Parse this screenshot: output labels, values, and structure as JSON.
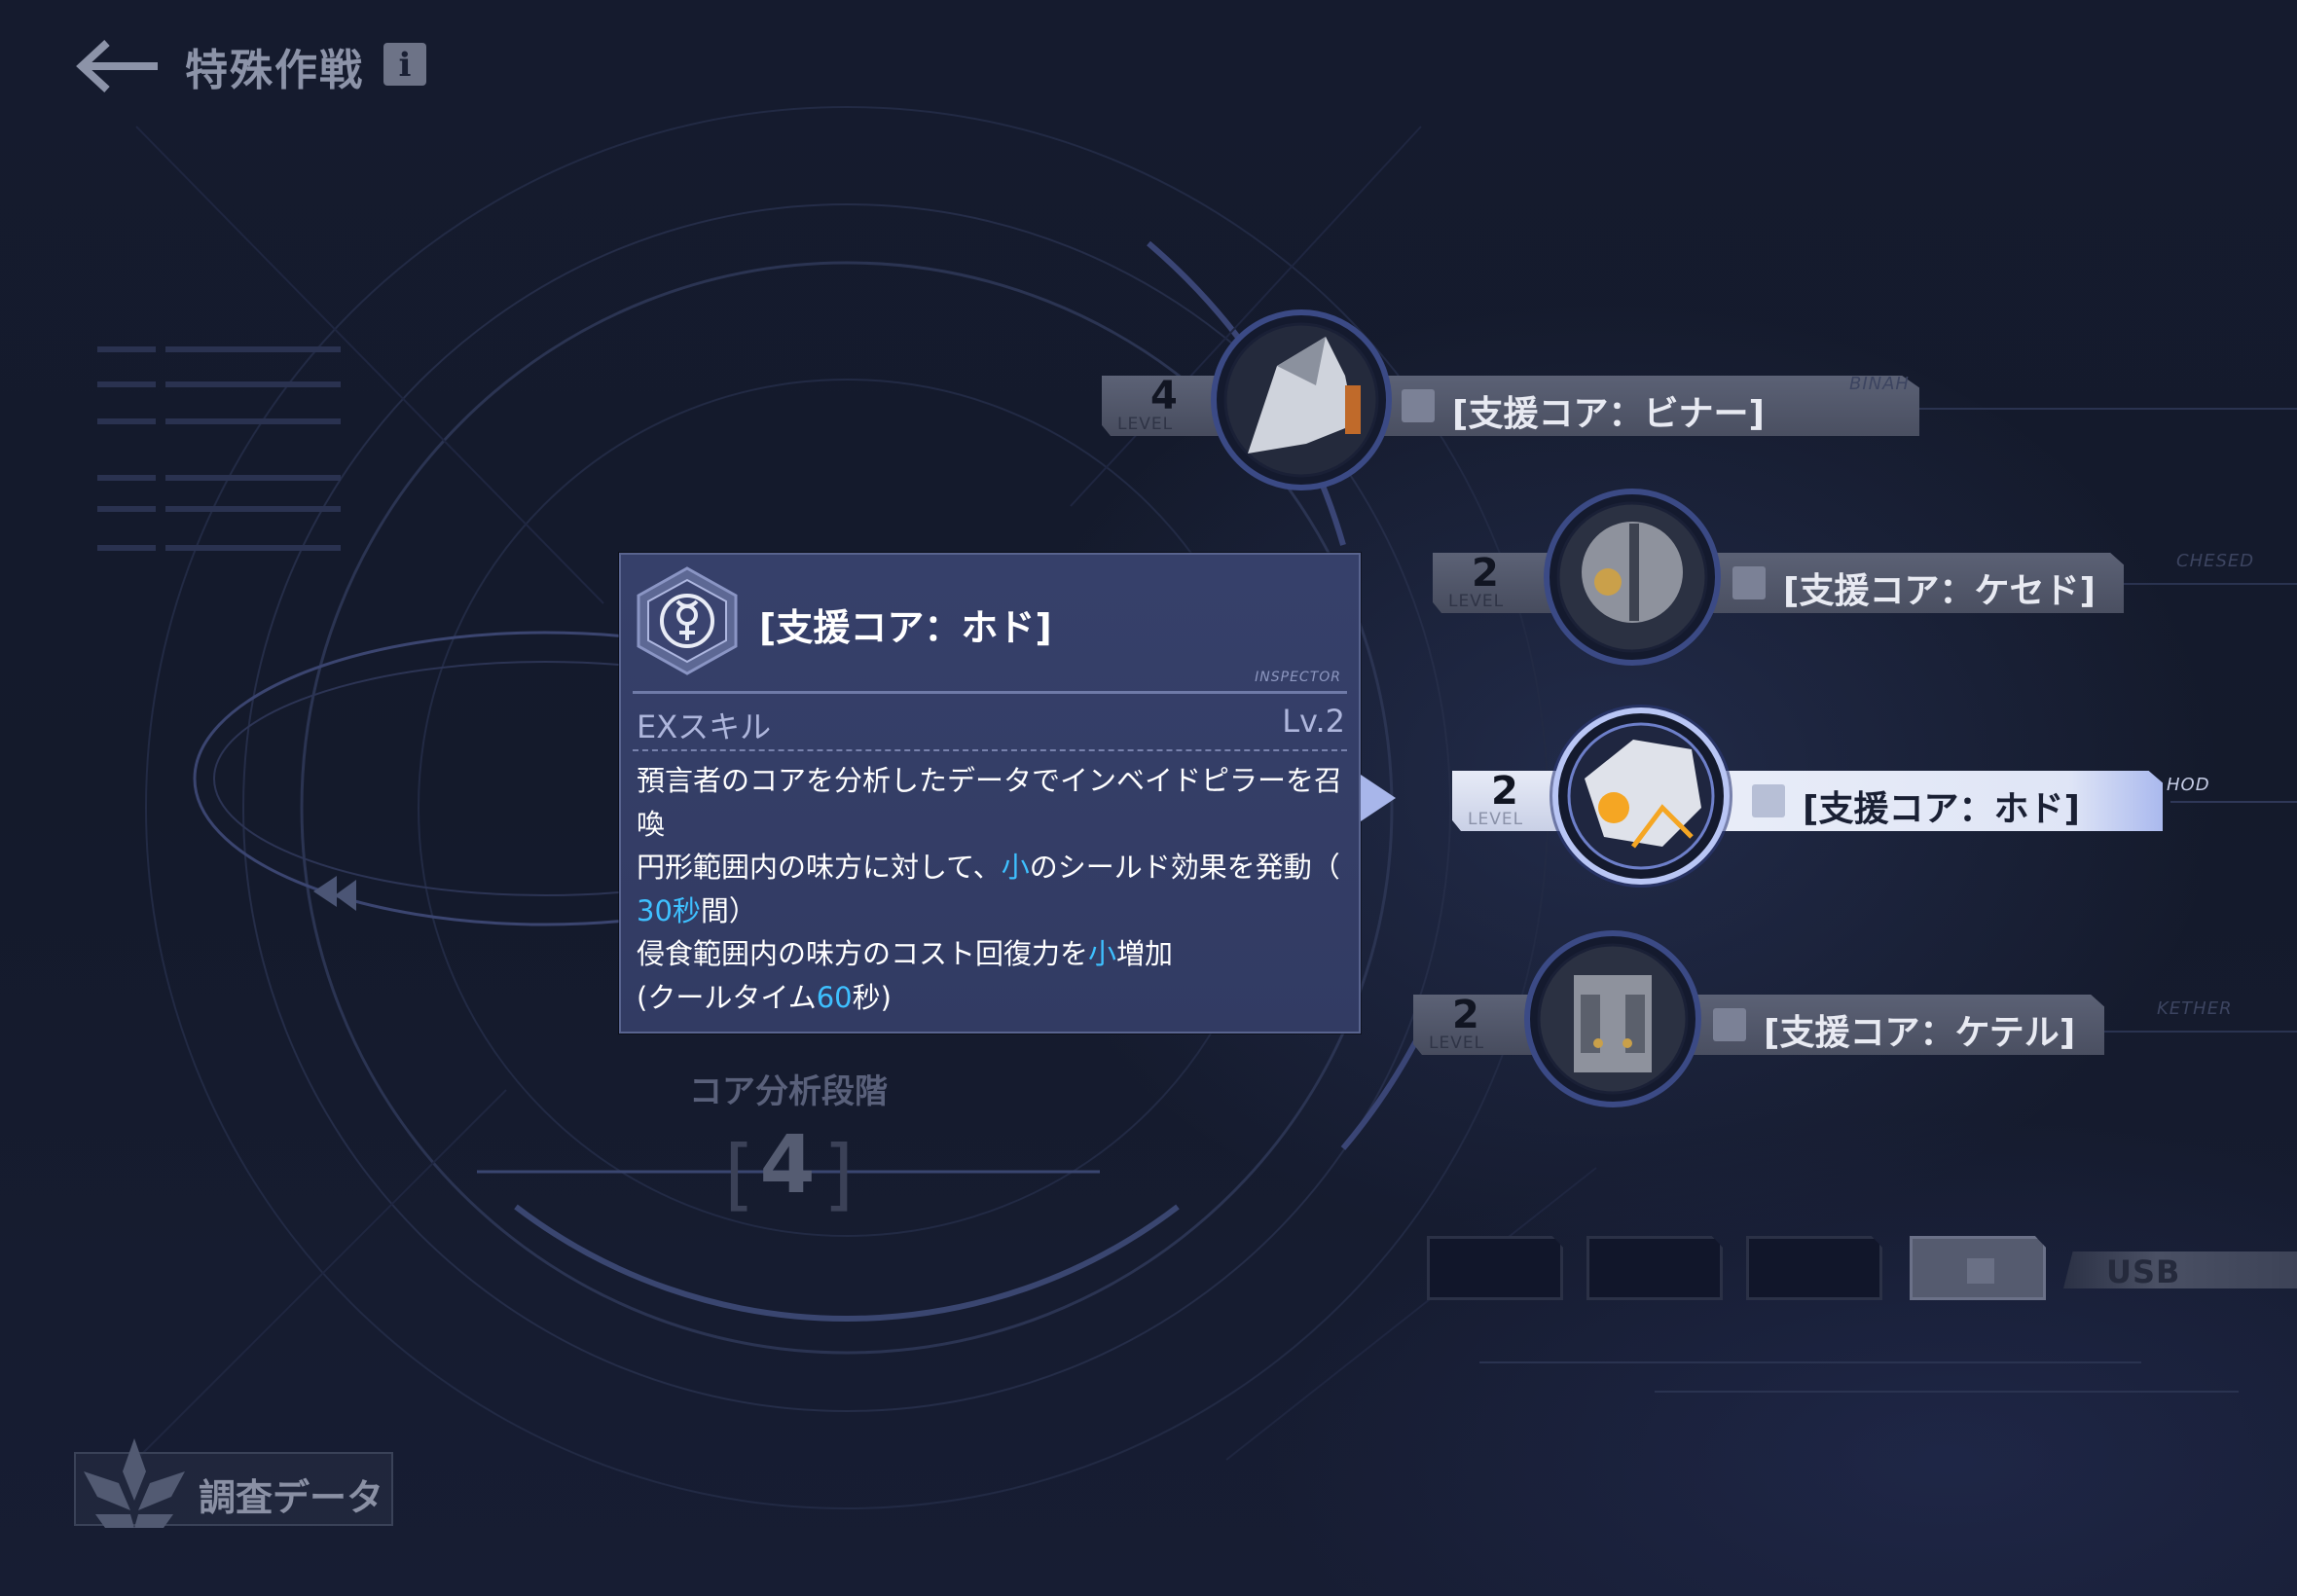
{
  "header": {
    "title": "特殊作戦",
    "info_label": "i"
  },
  "tooltip": {
    "title": "[支援コア：ホド]",
    "inspector_tag": "INSPECTOR",
    "skill_label": "EXスキル",
    "skill_level": "Lv.2",
    "desc": {
      "line1": "預言者のコアを分析したデータでインベイドピラーを召喚",
      "line2_pre": "円形範囲内の味方に対して、",
      "line2_hl": "小",
      "line2_post": "のシールド効果を発動（",
      "line3_hl": "30秒",
      "line3_post": "間）",
      "line4_pre": "侵食範囲内の味方のコスト回復力を",
      "line4_hl": "小",
      "line4_post": "増加",
      "line5_pre": "(クールタイム",
      "line5_hl": "60",
      "line5_post": "秒)"
    },
    "highlight_color": "#3ec0ff"
  },
  "analysis": {
    "label": "コア分析段階",
    "value": "4"
  },
  "cores": [
    {
      "level": "4",
      "level_word": "LEVEL",
      "name": "[支援コア：ビナー]",
      "tag": "BINAH",
      "icon": "binah-icon",
      "active": false
    },
    {
      "level": "2",
      "level_word": "LEVEL",
      "name": "[支援コア：ケセド]",
      "tag": "CHESED",
      "icon": "chesed-icon",
      "active": false
    },
    {
      "level": "2",
      "level_word": "LEVEL",
      "name": "[支援コア：ホド]",
      "tag": "HOD",
      "icon": "hod-icon",
      "active": true
    },
    {
      "level": "2",
      "level_word": "LEVEL",
      "name": "[支援コア：ケテル]",
      "tag": "KETHER",
      "icon": "kether-icon",
      "active": false
    }
  ],
  "slots": {
    "usb_label": "USB"
  },
  "survey": {
    "label": "調査データ"
  },
  "colors": {
    "background": "#141a2c",
    "tooltip_bg": "#36406a",
    "accent": "#3ec0ff"
  }
}
